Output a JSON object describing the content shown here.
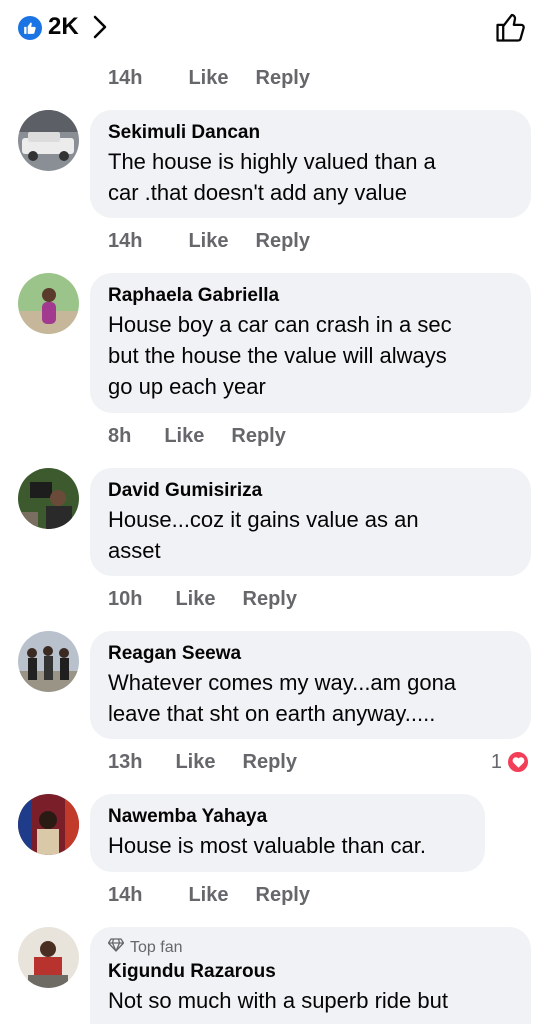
{
  "header": {
    "reaction_count": "2K"
  },
  "action_labels": {
    "like": "Like",
    "reply": "Reply"
  },
  "top_actions": {
    "time": "14h"
  },
  "comments": [
    {
      "author": "Sekimuli Dancan",
      "text": "The house is highly valued than a\ncar .that doesn't add any value",
      "time": "14h"
    },
    {
      "author": "Raphaela Gabriella",
      "text": "House boy a car can crash in a sec\nbut the house the value will always\ngo up each year",
      "time": "8h"
    },
    {
      "author": "David Gumisiriza",
      "text": "House...coz it gains value as an\nasset",
      "time": "10h"
    },
    {
      "author": "Reagan Seewa",
      "text": "Whatever comes my way...am gona\nleave that sht on earth anyway.....",
      "time": "13h",
      "reaction_count": "1"
    },
    {
      "author": "Nawemba Yahaya",
      "text": "House is most valuable than car.",
      "time": "14h"
    },
    {
      "badge": "Top fan",
      "author": "Kigundu Razarous",
      "text": "Not so much with a superb ride but"
    }
  ],
  "colors": {
    "accent_blue": "#1b74e4",
    "heart_red": "#f33e58",
    "bubble_bg": "#f0f2f5",
    "meta_gray": "#65676b"
  },
  "icons": [
    "like-thumb-icon",
    "chevron-right-icon",
    "thumbs-up-outline-icon",
    "heart-icon",
    "diamond-icon"
  ]
}
